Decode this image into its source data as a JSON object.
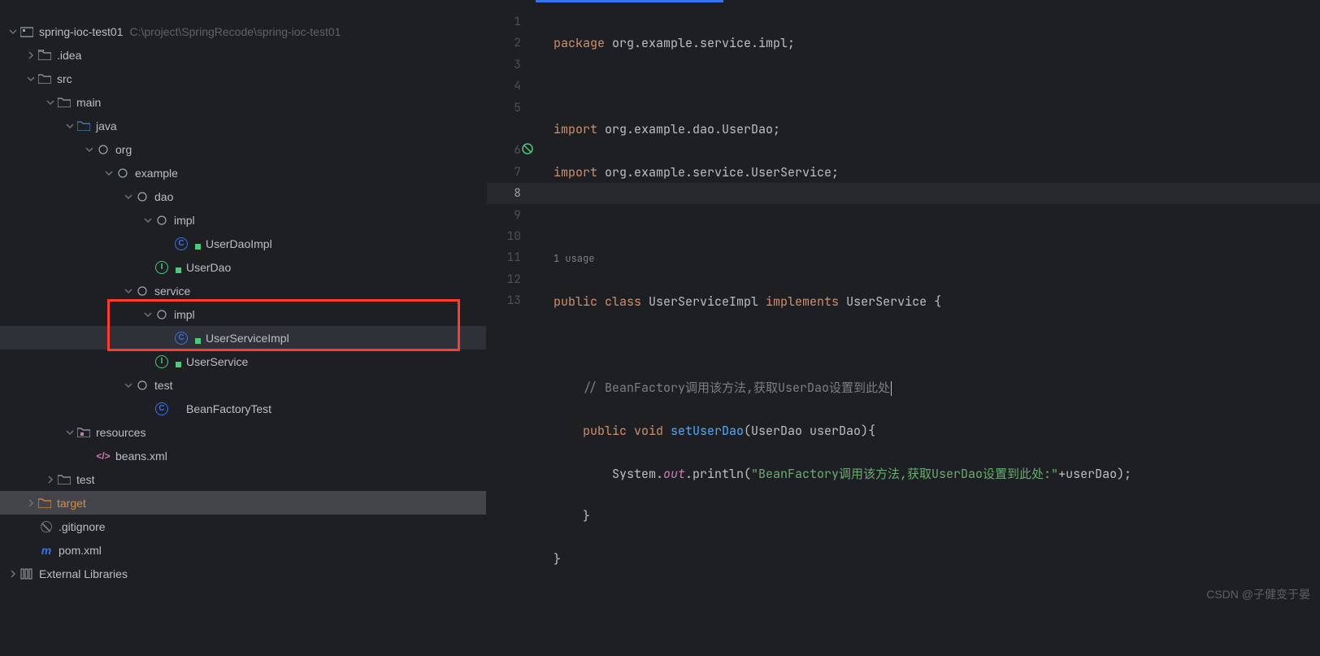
{
  "project": {
    "name": "spring-ioc-test01",
    "path": "C:\\project\\SpringRecode\\spring-ioc-test01",
    "tree": {
      "idea": ".idea",
      "src": "src",
      "main": "main",
      "java": "java",
      "org": "org",
      "example": "example",
      "dao": "dao",
      "dao_impl": "impl",
      "userDaoImpl": "UserDaoImpl",
      "userDao": "UserDao",
      "service": "service",
      "service_impl": "impl",
      "userServiceImpl": "UserServiceImpl",
      "userService": "UserService",
      "test_pkg": "test",
      "beanFactoryTest": "BeanFactoryTest",
      "resources": "resources",
      "beans_xml": "beans.xml",
      "test_dir": "test",
      "target": "target",
      "gitignore": ".gitignore",
      "pom": "pom.xml",
      "ext_lib": "External Libraries"
    }
  },
  "editor": {
    "usage_hint": "1 usage",
    "lines": {
      "l1_kw": "package",
      "l1_rest": " org.example.service.impl;",
      "l3_kw": "import",
      "l3_rest": " org.example.dao.UserDao;",
      "l4_kw": "import",
      "l4_rest": " org.example.service.UserService;",
      "l6_pub": "public ",
      "l6_cls": "class ",
      "l6_name": "UserServiceImpl ",
      "l6_impl": "implements ",
      "l6_iface": "UserService {",
      "l8_cmt": "    // BeanFactory调用该方法,获取UserDao设置到此处",
      "l9_pub": "    public ",
      "l9_void": "void ",
      "l9_fn": "setUserDao",
      "l9_sig": "(UserDao userDao){",
      "l10_pre": "        System.",
      "l10_out": "out",
      "l10_mid": ".println(",
      "l10_str": "\"BeanFactory调用该方法,获取UserDao设置到此处:\"",
      "l10_post": "+userDao);",
      "l11": "    }",
      "l12": "}"
    },
    "gutter": [
      "1",
      "2",
      "3",
      "4",
      "5",
      "",
      "6",
      "7",
      "8",
      "9",
      "10",
      "11",
      "12",
      "13"
    ]
  },
  "watermark": "CSDN @子健变于晏"
}
